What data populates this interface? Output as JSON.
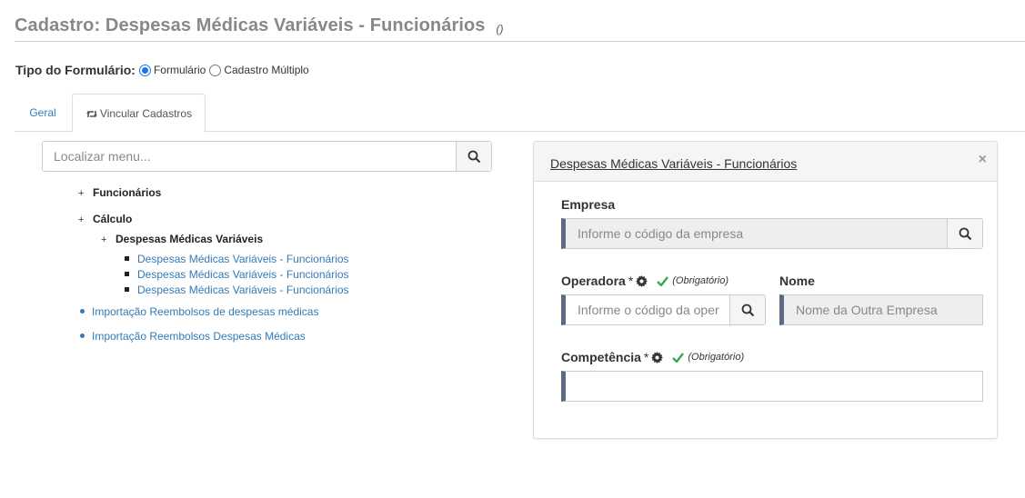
{
  "header": {
    "title": "Cadastro: Despesas Médicas Variáveis - Funcionários",
    "suffix": "()"
  },
  "form_type": {
    "label": "Tipo do Formulário:",
    "options": [
      "Formulário",
      "Cadastro Múltiplo"
    ],
    "selected": "Formulário"
  },
  "tabs": [
    {
      "label": "Geral",
      "active": false
    },
    {
      "label": "Vincular Cadastros",
      "active": true,
      "icon": "retweet-icon"
    }
  ],
  "menu_search": {
    "placeholder": "Localizar menu...",
    "icon": "search-icon"
  },
  "tree": {
    "funcionarios": "Funcionários",
    "calculo": "Cálculo",
    "despesas": "Despesas Médicas Variáveis",
    "links": [
      "Despesas Médicas Variáveis - Funcionários",
      "Despesas Médicas Variáveis - Funcionários",
      "Despesas Médicas Variáveis - Funcionários"
    ],
    "importacoes": [
      "Importação Reembolsos de despesas médicas",
      "Importação Reembolsos Despesas Médicas"
    ]
  },
  "panel": {
    "title": "Despesas Médicas Variáveis - Funcionários",
    "close": "×",
    "empresa": {
      "label": "Empresa",
      "placeholder": "Informe o código da empresa"
    },
    "operadora": {
      "label": "Operadora",
      "required": "*",
      "note": "(Obrigatório)",
      "placeholder": "Informe o código da oper"
    },
    "nome": {
      "label": "Nome",
      "placeholder": "Nome da Outra Empresa"
    },
    "competencia": {
      "label": "Competência",
      "required": "*",
      "note": "(Obrigatório)",
      "value": ""
    }
  },
  "colors": {
    "link": "#337ab7",
    "accent_bar": "#5b6b85",
    "check": "#3aa655",
    "radio": "#1a73e8"
  }
}
